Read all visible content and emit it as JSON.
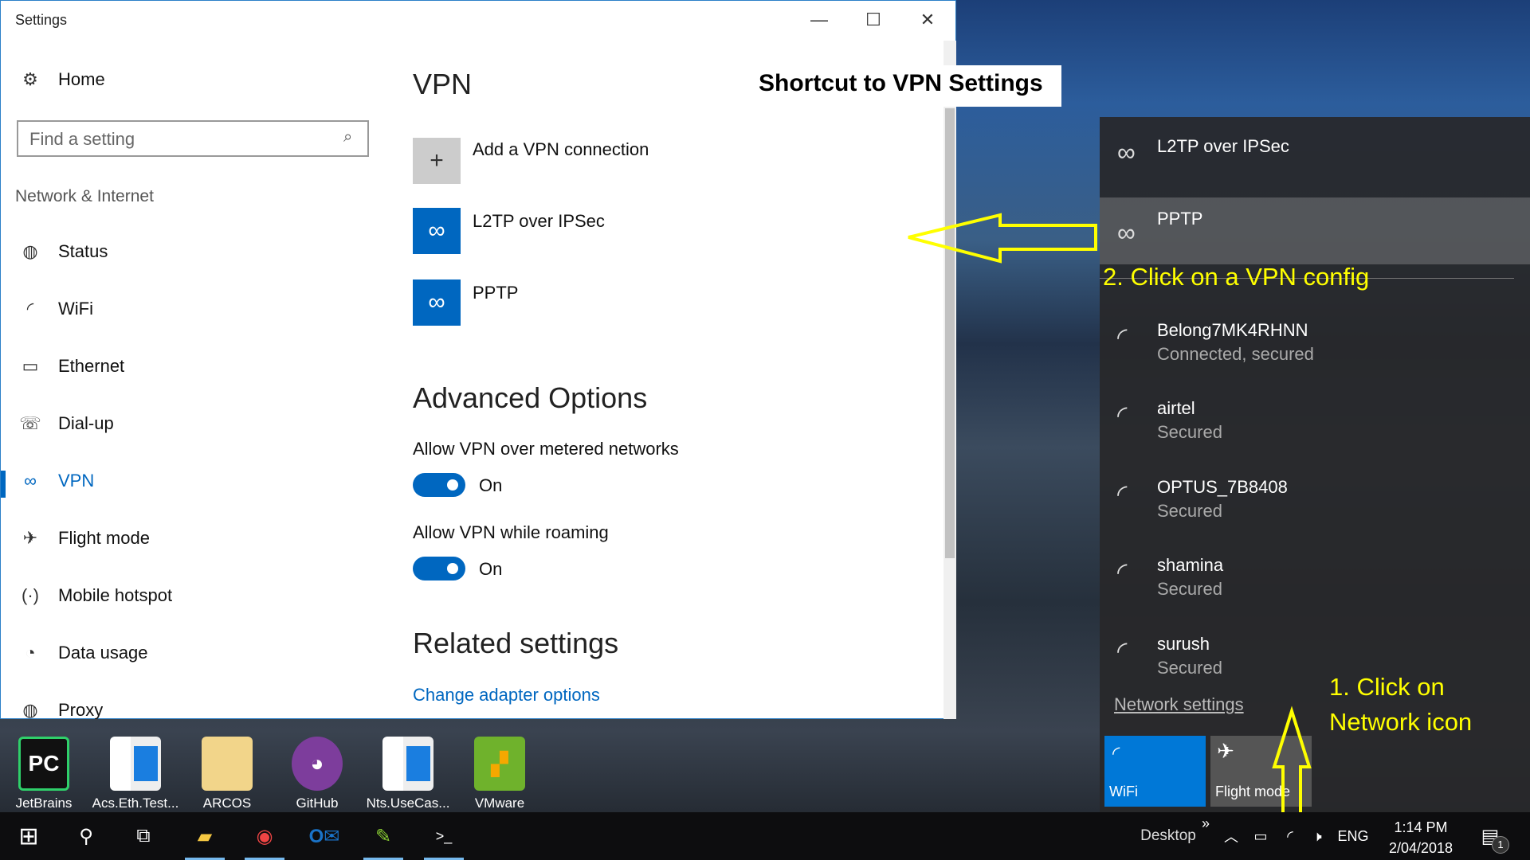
{
  "window": {
    "title": "Settings",
    "minimize": "—",
    "maximize": "☐",
    "close": "✕"
  },
  "sidebar": {
    "home": "Home",
    "search_placeholder": "Find a setting",
    "section": "Network & Internet",
    "items": [
      {
        "label": "Status",
        "icon": "globe-icon"
      },
      {
        "label": "WiFi",
        "icon": "wifi-icon"
      },
      {
        "label": "Ethernet",
        "icon": "ethernet-icon"
      },
      {
        "label": "Dial-up",
        "icon": "dialup-icon"
      },
      {
        "label": "VPN",
        "icon": "vpn-icon"
      },
      {
        "label": "Flight mode",
        "icon": "airplane-icon"
      },
      {
        "label": "Mobile hotspot",
        "icon": "hotspot-icon"
      },
      {
        "label": "Data usage",
        "icon": "data-usage-icon"
      },
      {
        "label": "Proxy",
        "icon": "globe-icon"
      }
    ]
  },
  "main": {
    "title": "VPN",
    "add_label": "Add a VPN connection",
    "connections": [
      "L2TP over IPSec",
      "PPTP"
    ],
    "advanced_title": "Advanced Options",
    "toggles": [
      {
        "label": "Allow VPN over metered networks",
        "state": "On"
      },
      {
        "label": "Allow VPN while roaming",
        "state": "On"
      }
    ],
    "related_title": "Related settings",
    "related_link": "Change adapter options"
  },
  "annotations": {
    "shortcut": "Shortcut to VPN Settings",
    "step2": "2. Click on a VPN config",
    "step1_line1": "1. Click on",
    "step1_line2": "Network icon"
  },
  "flyout": {
    "vpns": [
      "L2TP over IPSec",
      "PPTP"
    ],
    "networks": [
      {
        "name": "Belong7MK4RHNN",
        "status": "Connected, secured"
      },
      {
        "name": "airtel",
        "status": "Secured"
      },
      {
        "name": "OPTUS_7B8408",
        "status": "Secured"
      },
      {
        "name": "shamina",
        "status": "Secured"
      },
      {
        "name": "surush",
        "status": "Secured"
      }
    ],
    "network_settings": "Network settings",
    "tiles": [
      "WiFi",
      "Flight mode"
    ]
  },
  "desktop": [
    "JetBrains",
    "Acs.Eth.Test...",
    "ARCOS",
    "GitHub",
    "Nts.UseCas...",
    "VMware"
  ],
  "tray": {
    "desktop": "Desktop",
    "chevron": "»",
    "lang": "ENG",
    "time": "1:14 PM",
    "date": "2/04/2018",
    "notifications": "1"
  }
}
